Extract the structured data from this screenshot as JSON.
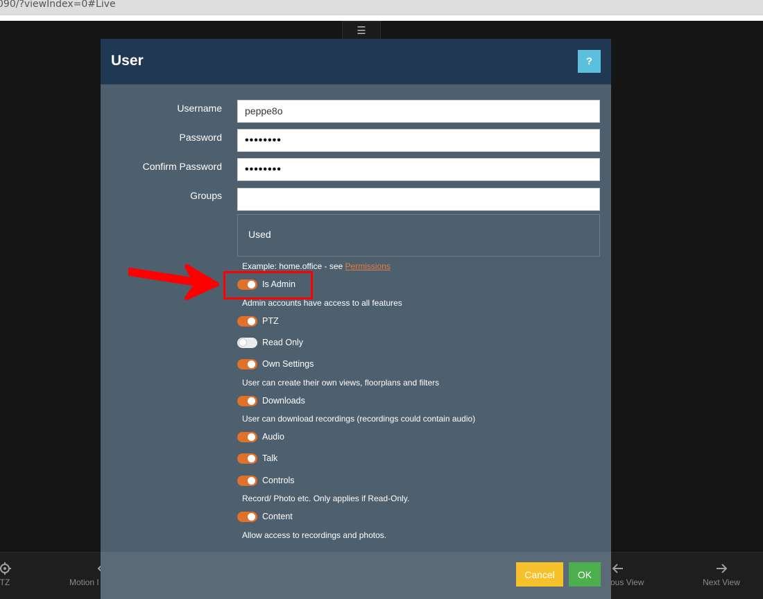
{
  "browser": {
    "url_fragment": "090/?viewIndex=0#Live"
  },
  "toolbar": {
    "menu_icon": "hamburger-icon",
    "menu_glyph": "☰"
  },
  "bottom_bar": [
    {
      "label": "TZ",
      "icon": "ptz-icon"
    },
    {
      "label": "Motion I",
      "icon": "motion-icon"
    },
    {
      "label": "ous View",
      "icon": "arrow-left-icon"
    },
    {
      "label": "Next View",
      "icon": "arrow-right-icon"
    }
  ],
  "dialog": {
    "title": "User",
    "help_label": "?",
    "fields": {
      "username_label": "Username",
      "username_value": "peppe8o",
      "password_label": "Password",
      "password_value": "••••••••",
      "confirm_label": "Confirm Password",
      "confirm_value": "••••••••",
      "groups_label": "Groups",
      "groups_value": ""
    },
    "used_label": "Used",
    "groups_hint_prefix": "Example: home.office - see ",
    "groups_hint_link": "Permissions",
    "toggles": [
      {
        "label": "Is Admin",
        "on": true,
        "hint": "Admin accounts have access to all features"
      },
      {
        "label": "PTZ",
        "on": true,
        "hint": ""
      },
      {
        "label": "Read Only",
        "on": false,
        "hint": ""
      },
      {
        "label": "Own Settings",
        "on": true,
        "hint": "User can create their own views, floorplans and filters"
      },
      {
        "label": "Downloads",
        "on": true,
        "hint": "User can download recordings (recordings could contain audio)"
      },
      {
        "label": "Audio",
        "on": true,
        "hint": ""
      },
      {
        "label": "Talk",
        "on": true,
        "hint": ""
      },
      {
        "label": "Controls",
        "on": true,
        "hint": "Record/ Photo etc. Only applies if Read-Only."
      },
      {
        "label": "Content",
        "on": true,
        "hint": "Allow access to recordings and photos."
      }
    ],
    "cancel_label": "Cancel",
    "ok_label": "OK"
  },
  "colors": {
    "toggle_on": "#e0712a",
    "header": "#213852",
    "cancel": "#f6c12a",
    "ok": "#4cae4c",
    "help": "#5bc0de",
    "annotation": "#ff0000"
  }
}
